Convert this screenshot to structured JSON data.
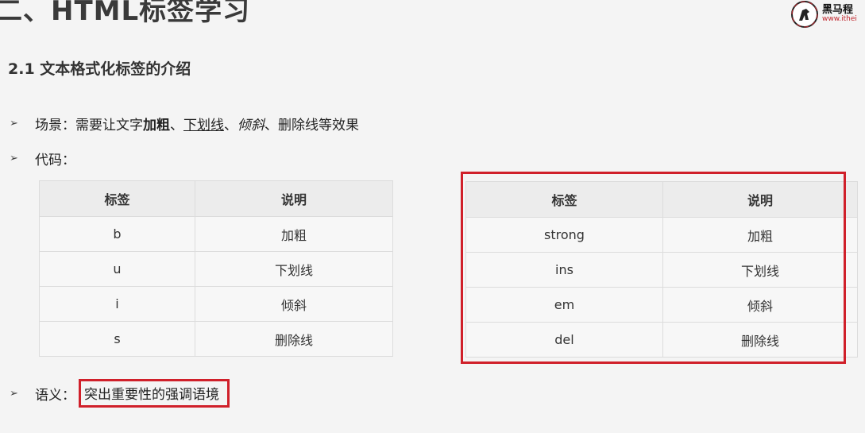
{
  "header": {
    "title": "二、HTML标签学习",
    "logo": {
      "name": "黑马程",
      "url": "www.ithei"
    }
  },
  "section": {
    "title": "2.1 文本格式化标签的介绍"
  },
  "bullets": {
    "scene": {
      "label": "场景：需要让文字",
      "bold": "加粗",
      "sep1": "、",
      "underline": "下划线",
      "sep2": "、",
      "italic": "倾斜",
      "rest": "、删除线等效果"
    },
    "code": {
      "label": "代码："
    },
    "semantic": {
      "label": "语义：",
      "value": "突出重要性的强调语境"
    }
  },
  "table_left": {
    "headers": [
      "标签",
      "说明"
    ],
    "rows": [
      [
        "b",
        "加粗"
      ],
      [
        "u",
        "下划线"
      ],
      [
        "i",
        "倾斜"
      ],
      [
        "s",
        "删除线"
      ]
    ]
  },
  "table_right": {
    "headers": [
      "标签",
      "说明"
    ],
    "rows": [
      [
        "strong",
        "加粗"
      ],
      [
        "ins",
        "下划线"
      ],
      [
        "em",
        "倾斜"
      ],
      [
        "del",
        "删除线"
      ]
    ]
  },
  "colors": {
    "highlight_border": "#d0202a",
    "logo_accent": "#c0262d"
  },
  "icons": {
    "bullet": "arrow-right-icon",
    "logo": "horse-logo-icon"
  }
}
